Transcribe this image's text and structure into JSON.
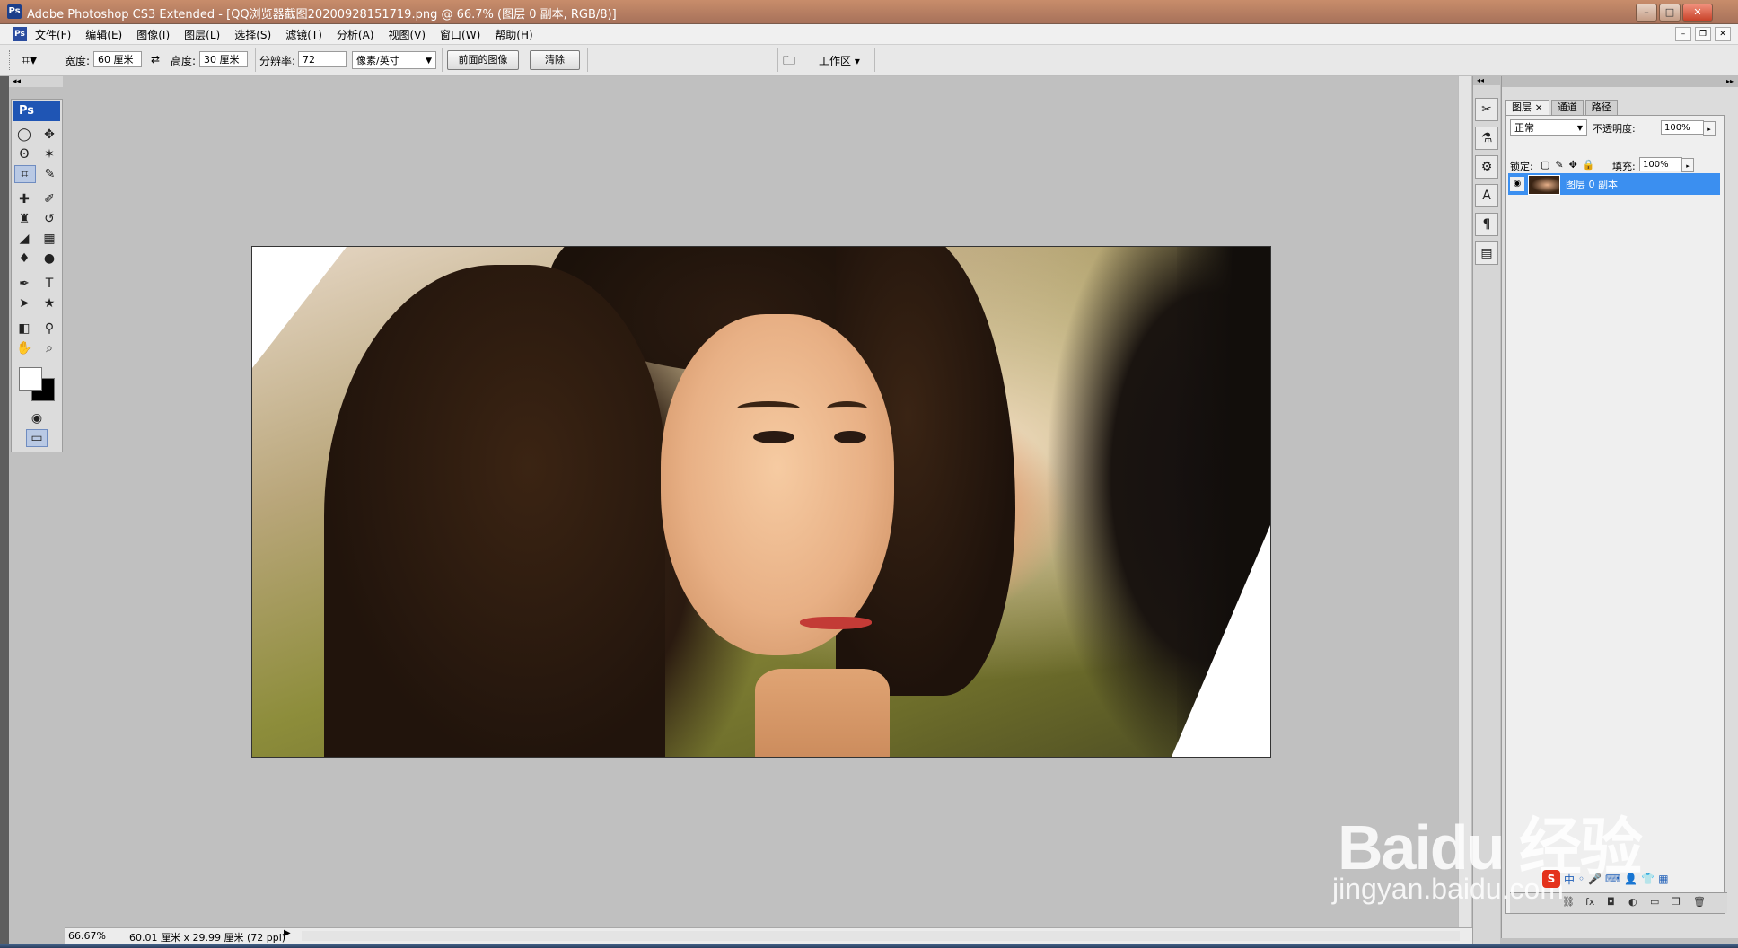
{
  "window": {
    "title": "Adobe Photoshop CS3 Extended - [QQ浏览器截图20200928151719.png @ 66.7% (图层 0 副本, RGB/8)]",
    "app_logo": "Ps",
    "buttons": [
      "–",
      "□",
      "✕"
    ]
  },
  "menubar": {
    "logo": "Ps",
    "items": [
      "文件(F)",
      "编辑(E)",
      "图像(I)",
      "图层(L)",
      "选择(S)",
      "滤镜(T)",
      "分析(A)",
      "视图(V)",
      "窗口(W)",
      "帮助(H)"
    ],
    "doc_buttons": [
      "–",
      "❐",
      "✕"
    ]
  },
  "options": {
    "width_label": "宽度:",
    "width_value": "60 厘米",
    "height_label": "高度:",
    "height_value": "30 厘米",
    "resolution_label": "分辨率:",
    "resolution_value": "72",
    "units": "像素/英寸",
    "front_image_btn": "前面的图像",
    "clear_btn": "清除",
    "workspace_label": "工作区 ▾"
  },
  "toolbox": {
    "badge": "Ps"
  },
  "layers_panel": {
    "tabs": [
      "图层 ×",
      "通道",
      "路径"
    ],
    "blend_mode": "正常",
    "opacity_label": "不透明度:",
    "opacity_value": "100%",
    "lock_label": "锁定:",
    "fill_label": "填充:",
    "fill_value": "100%",
    "layer_name": "图层 0 副本"
  },
  "status": {
    "zoom": "66.67%",
    "doc_info": "60.01 厘米 x 29.99 厘米 (72 ppi)"
  },
  "watermark": {
    "brand": "Baidu 经验",
    "url": "jingyan.baidu.com"
  },
  "ime": {
    "logo": "S",
    "mode": "中"
  }
}
